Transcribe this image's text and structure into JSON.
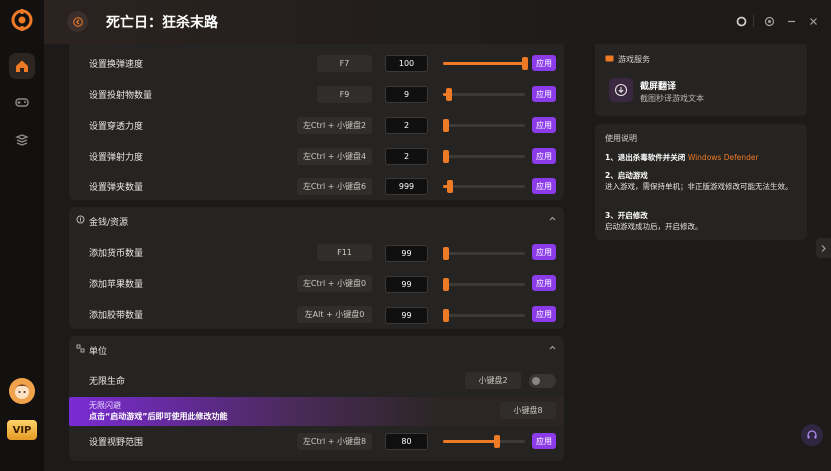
{
  "header": {
    "title": "死亡日：狂杀末路"
  },
  "rows_top": [
    {
      "label": "设置换弹速度",
      "key": "F7",
      "value": "100",
      "fill": 1.0
    },
    {
      "label": "设置投射物数量",
      "key": "F9",
      "value": "9",
      "fill": 0.07
    },
    {
      "label": "设置穿透力度",
      "key": "左Ctrl + 小键盘2",
      "value": "2",
      "fill": 0.0
    },
    {
      "label": "设置弹射力度",
      "key": "左Ctrl + 小键盘4",
      "value": "2",
      "fill": 0.0
    },
    {
      "label": "设置弹夹数量",
      "key": "左Ctrl + 小键盘6",
      "value": "999",
      "fill": 0.09
    }
  ],
  "section_money": {
    "title": "金钱/资源",
    "rows": [
      {
        "label": "添加货币数量",
        "key": "F11",
        "value": "99",
        "fill": 0.0
      },
      {
        "label": "添加苹果数量",
        "key": "左Ctrl + 小键盘0",
        "value": "99",
        "fill": 0.0
      },
      {
        "label": "添加胶带数量",
        "key": "左Alt + 小键盘0",
        "value": "99",
        "fill": 0.0
      }
    ]
  },
  "section_unit": {
    "title": "单位",
    "god_mode": {
      "label": "无限生命",
      "key": "小键盘2",
      "enabled": false
    },
    "promo": {
      "line1": "无限闪避",
      "line2": "点击“启动游戏”后即可使用此修改功能",
      "key": "小键盘8"
    },
    "view_row": {
      "label": "设置视野范围",
      "key": "左Ctrl + 小键盘8",
      "value": "80",
      "fill": 0.66
    }
  },
  "apply_label": "应用",
  "service": {
    "title": "游戏服务",
    "name": "截屏翻译",
    "desc": "截图秒译游戏文本"
  },
  "guide": {
    "title": "使用说明",
    "step1_title": "1、退出杀毒软件并关闭 ",
    "step1_highlight": "Windows Defender",
    "step2_title": "2、启动游戏",
    "step2_text": "进入游戏，需保持单机；非正版游戏修改可能无法生效。",
    "step3_title": "3、开启修改",
    "step3_text": "启动游戏成功后，开启修改。"
  },
  "colors": {
    "accent": "#ee7a25",
    "purple": "#8b3be8",
    "bg": "#1d1b1a",
    "panel": "#262422"
  },
  "icons": [
    "app-logo-icon",
    "home-icon",
    "gamepad-icon",
    "stack-icon",
    "back-arrow-icon",
    "record-icon",
    "sync-icon",
    "minimize-icon",
    "close-icon",
    "screenshot-translate-icon",
    "headset-icon",
    "chevron-right-icon",
    "chevron-up-icon",
    "coin-icon",
    "unit-icon"
  ]
}
